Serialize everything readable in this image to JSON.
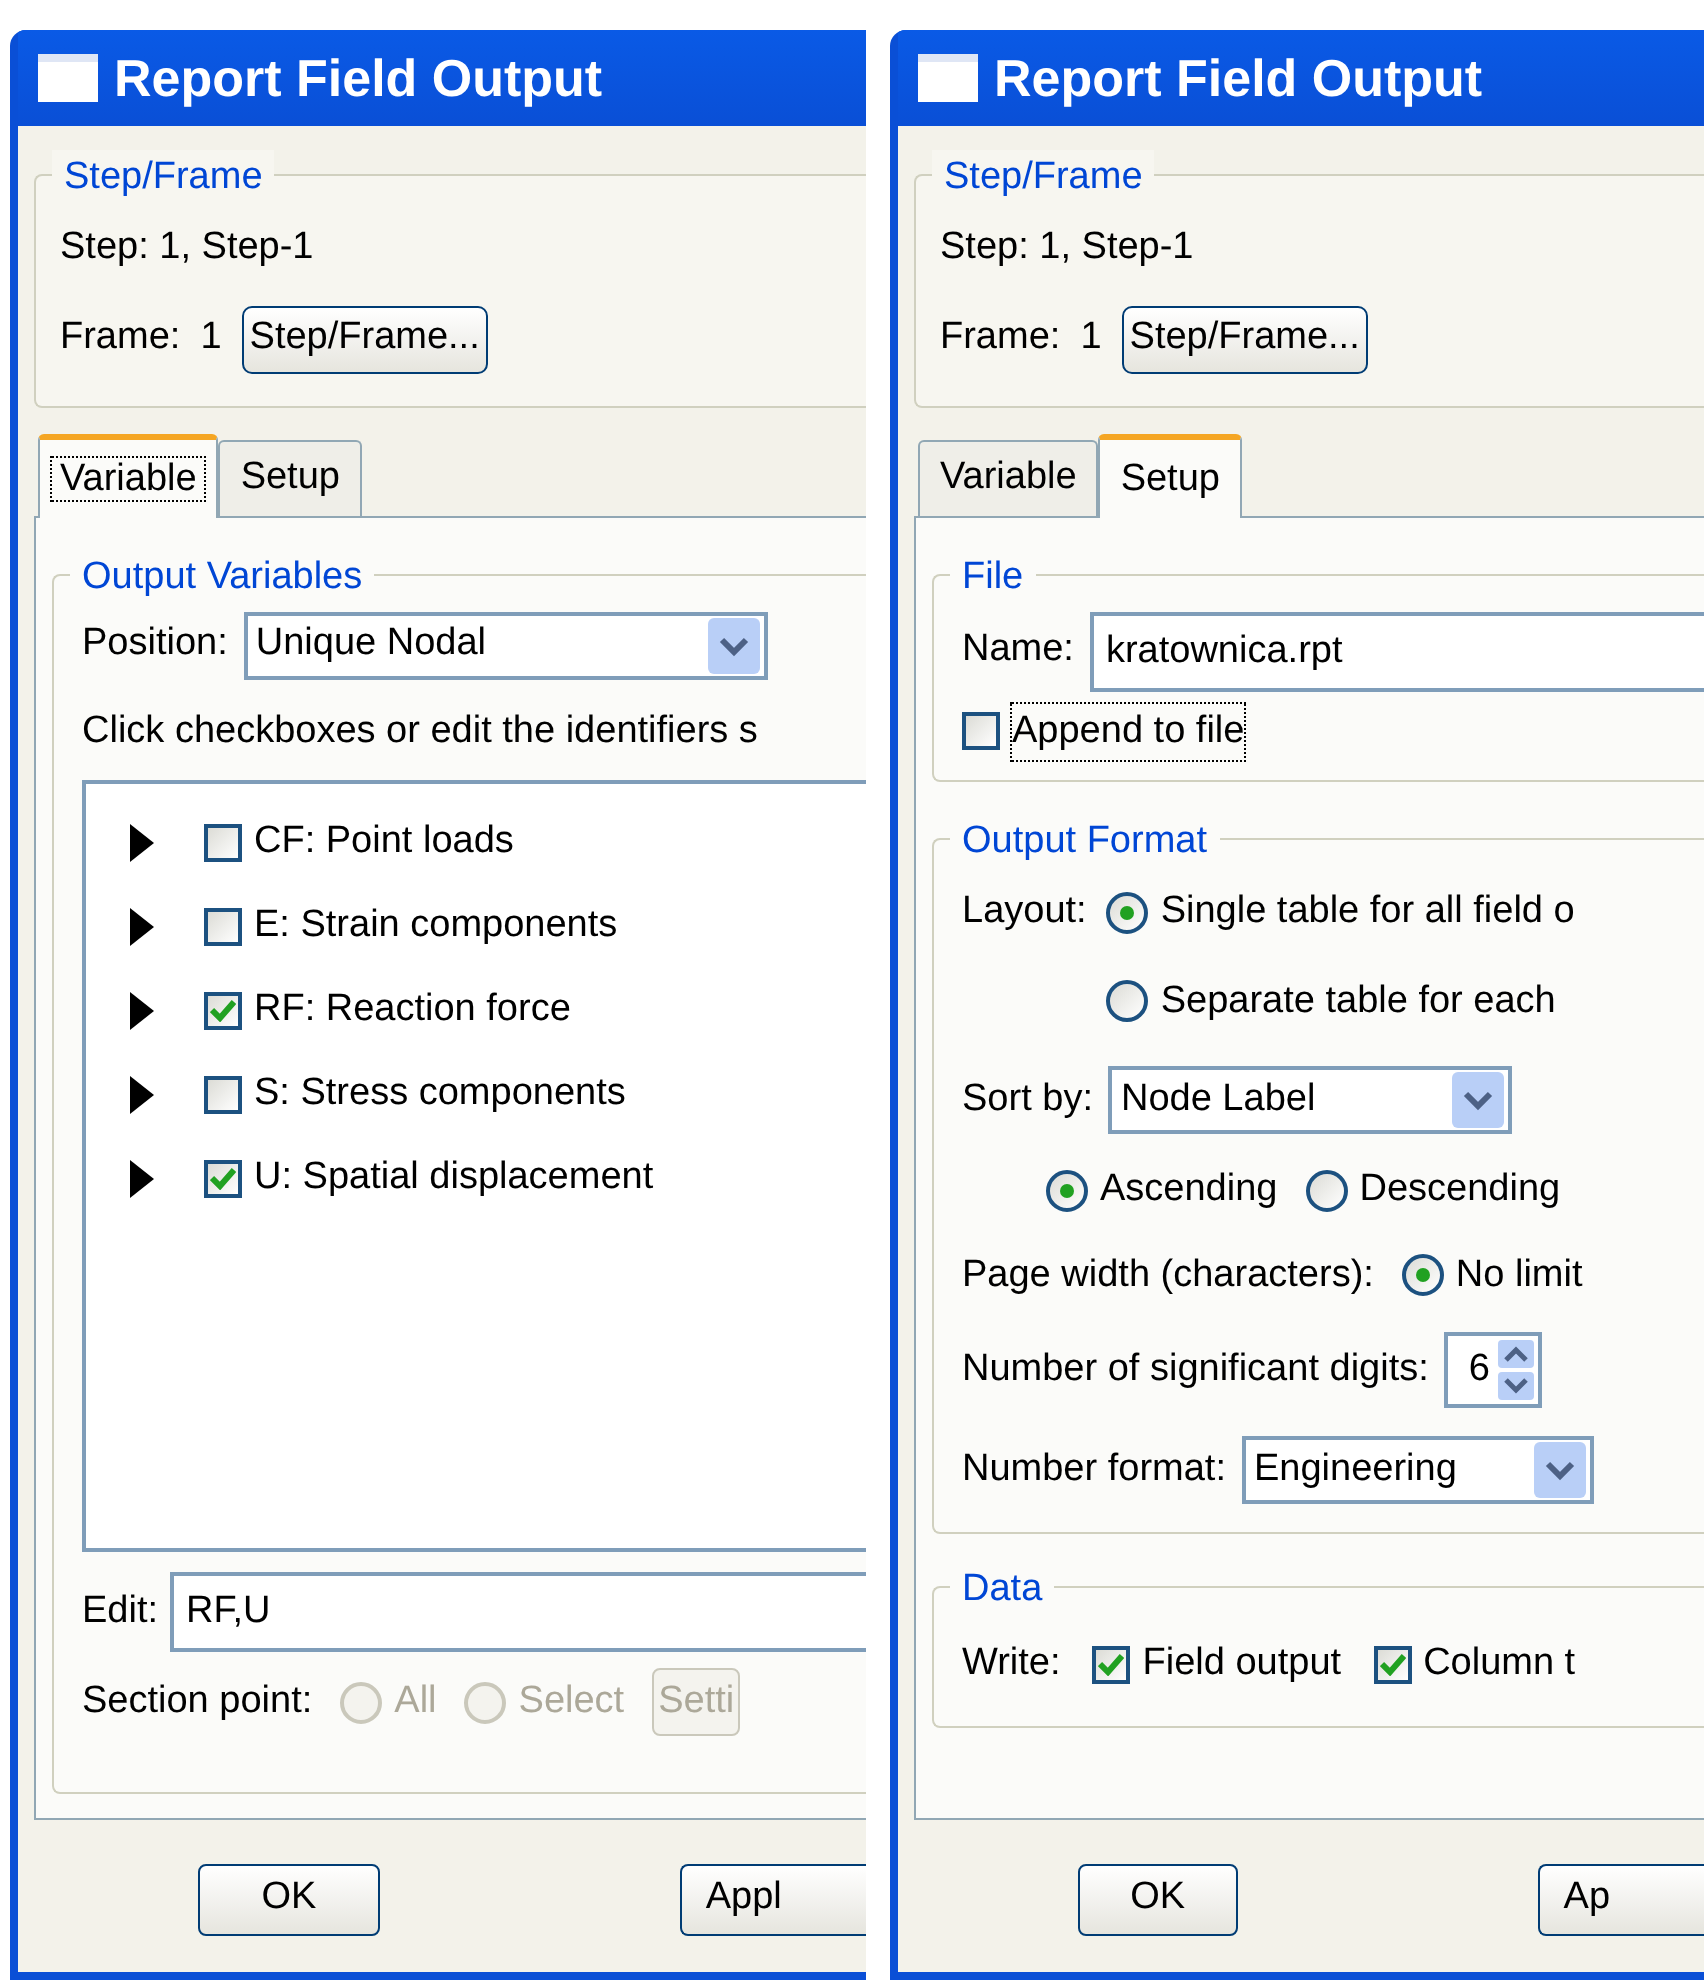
{
  "dialogs": [
    {
      "title": "Report Field Output",
      "step_frame": {
        "legend": "Step/Frame",
        "step_text": "Step: 1, Step-1",
        "frame_label": "Frame:",
        "frame_value": "1",
        "button": "Step/Frame..."
      },
      "tabs": [
        {
          "label": "Variable",
          "selected": true,
          "focused": true
        },
        {
          "label": "Setup",
          "selected": false,
          "focused": false
        }
      ],
      "panel": {
        "kind": "variable",
        "legend": "Output Variables",
        "position_label": "Position:",
        "position_value": "Unique Nodal",
        "hint": "Click checkboxes or edit the identifiers s",
        "variables": [
          {
            "label": "CF: Point loads",
            "checked": false
          },
          {
            "label": "E: Strain components",
            "checked": false
          },
          {
            "label": "RF: Reaction force",
            "checked": true
          },
          {
            "label": "S: Stress components",
            "checked": false
          },
          {
            "label": "U: Spatial displacement",
            "checked": true
          }
        ],
        "edit_label": "Edit:",
        "edit_value": "RF,U",
        "section_label": "Section point:",
        "section_options": [
          {
            "label": "All",
            "selected": false,
            "disabled": true
          },
          {
            "label": "Select",
            "selected": false,
            "disabled": true
          }
        ],
        "settings_button": {
          "label": "Setti",
          "disabled": true
        }
      },
      "buttons": [
        "OK",
        "Appl"
      ]
    },
    {
      "title": "Report Field Output",
      "step_frame": {
        "legend": "Step/Frame",
        "step_text": "Step: 1, Step-1",
        "frame_label": "Frame:",
        "frame_value": "1",
        "button": "Step/Frame..."
      },
      "tabs": [
        {
          "label": "Variable",
          "selected": false,
          "focused": false
        },
        {
          "label": "Setup",
          "selected": true,
          "focused": false
        }
      ],
      "panel": {
        "kind": "setup",
        "file": {
          "legend": "File",
          "name_label": "Name:",
          "name_value": "kratownica.rpt",
          "append": {
            "label": "Append to file",
            "checked": false,
            "focused": true
          }
        },
        "output_format": {
          "legend": "Output Format",
          "layout_label": "Layout:",
          "layout_options": [
            {
              "label": "Single table for all field o",
              "selected": true
            },
            {
              "label": "Separate table for each",
              "selected": false
            }
          ],
          "sort_label": "Sort by:",
          "sort_value": "Node Label",
          "order_options": [
            {
              "label": "Ascending",
              "selected": true
            },
            {
              "label": "Descending",
              "selected": false
            }
          ],
          "page_width_label": "Page width (characters):",
          "page_width_options": [
            {
              "label": "No limit",
              "selected": true
            }
          ],
          "digits_label": "Number of significant digits:",
          "digits_value": "6",
          "number_format_label": "Number format:",
          "number_format_value": "Engineering"
        },
        "data": {
          "legend": "Data",
          "write_label": "Write:",
          "options": [
            {
              "label": "Field output",
              "checked": true
            },
            {
              "label": "Column t",
              "checked": true
            }
          ]
        }
      },
      "buttons": [
        "OK",
        "Ap"
      ]
    }
  ]
}
